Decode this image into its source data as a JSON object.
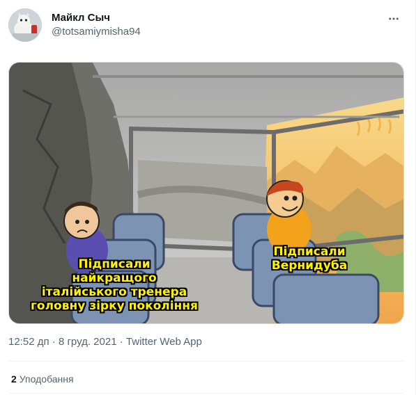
{
  "tweet": {
    "author_name": "Майкл Сыч",
    "author_handle": "@totsamiymisha94",
    "meme": {
      "left_caption": "Підписали\nнайкращого\nіталійського тренера\nголовну зірку покоління",
      "right_caption": "Підписали\nВернидуба"
    },
    "time": "12:52 дп",
    "date": "8 груд. 2021",
    "separator": "·",
    "source": "Twitter Web App",
    "like_count": "2",
    "like_label": "Уподобання"
  },
  "colors": {
    "text_primary": "#0f1419",
    "text_secondary": "#536471",
    "border": "#eff3f4",
    "meme_caption": "#fff200"
  }
}
